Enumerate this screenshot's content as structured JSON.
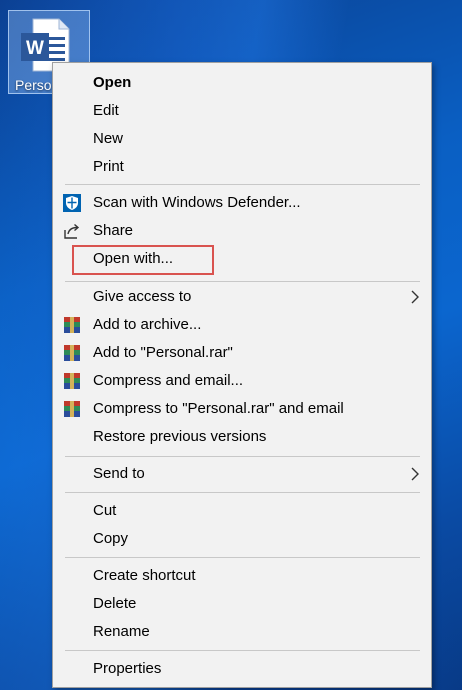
{
  "desktop": {
    "icon_label": "Perso"
  },
  "menu": {
    "groups": [
      [
        {
          "label": "Open",
          "bold": true
        },
        {
          "label": "Edit"
        },
        {
          "label": "New"
        },
        {
          "label": "Print"
        }
      ],
      [
        {
          "label": "Scan with Windows Defender...",
          "icon": "defender-shield-icon"
        },
        {
          "label": "Share",
          "icon": "share-icon"
        },
        {
          "label": "Open with...",
          "highlighted": true
        }
      ],
      [
        {
          "label": "Give access to",
          "submenu": true
        },
        {
          "label": "Add to archive...",
          "icon": "winrar-icon"
        },
        {
          "label": "Add to \"Personal.rar\"",
          "icon": "winrar-icon"
        },
        {
          "label": "Compress and email...",
          "icon": "winrar-icon"
        },
        {
          "label": "Compress to \"Personal.rar\" and email",
          "icon": "winrar-icon"
        },
        {
          "label": "Restore previous versions"
        }
      ],
      [
        {
          "label": "Send to",
          "submenu": true
        }
      ],
      [
        {
          "label": "Cut"
        },
        {
          "label": "Copy"
        }
      ],
      [
        {
          "label": "Create shortcut"
        },
        {
          "label": "Delete"
        },
        {
          "label": "Rename"
        }
      ],
      [
        {
          "label": "Properties"
        }
      ]
    ]
  },
  "colors": {
    "highlight_border": "#d9534f",
    "menu_bg": "#f2f2f2",
    "defender_blue": "#0063b1",
    "word_blue": "#2b579a"
  }
}
